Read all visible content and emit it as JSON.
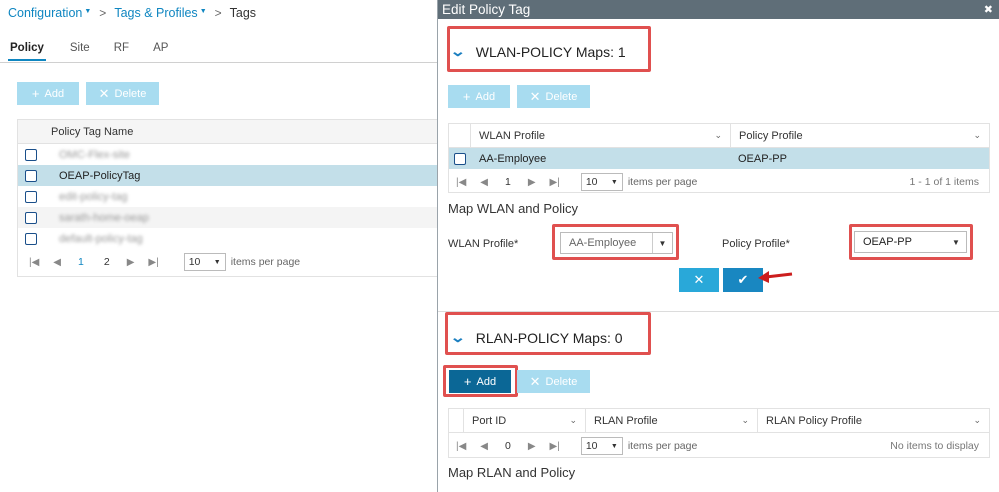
{
  "breadcrumb": {
    "configuration": "Configuration",
    "tags_profiles": "Tags & Profiles",
    "current": "Tags",
    "caret": "▼",
    "sep": ">"
  },
  "tabs": [
    "Policy",
    "Site",
    "RF",
    "AP"
  ],
  "left": {
    "add_label": "Add",
    "delete_label": "Delete",
    "column_header": "Policy Tag Name",
    "rows": [
      "OMC-Flex-site",
      "OEAP-PolicyTag",
      "edit-policy-tag",
      "sarath-home-oeap",
      "default-policy-tag"
    ],
    "pager": {
      "page1": "1",
      "page2": "2",
      "per_page": "10",
      "per_page_label": "items per page"
    }
  },
  "modal": {
    "title": "Edit Policy Tag",
    "wlan_section": "WLAN-POLICY Maps: 1",
    "add_label": "Add",
    "delete_label": "Delete",
    "wlan_table": {
      "col1": "WLAN Profile",
      "col2": "Policy Profile",
      "row": {
        "wlan": "AA-Employee",
        "policy": "OEAP-PP"
      },
      "pager": {
        "page": "1",
        "per_page": "10",
        "per_page_label": "items per page",
        "count": "1 - 1 of 1 items"
      }
    },
    "map_wlan_title": "Map WLAN and Policy",
    "wlan_profile_label": "WLAN Profile*",
    "wlan_profile_value": "AA-Employee",
    "policy_profile_label": "Policy Profile*",
    "policy_profile_value": "OEAP-PP",
    "rlan_section": "RLAN-POLICY Maps: 0",
    "rlan_table": {
      "col1": "Port ID",
      "col2": "RLAN Profile",
      "col3": "RLAN Policy Profile",
      "pager": {
        "page": "0",
        "per_page": "10",
        "per_page_label": "items per page",
        "count": "No items to display"
      }
    },
    "map_rlan_title": "Map RLAN and Policy"
  },
  "colors": {
    "accent": "#0f86c1",
    "highlight": "#e0504f",
    "header": "#5f6e78"
  }
}
